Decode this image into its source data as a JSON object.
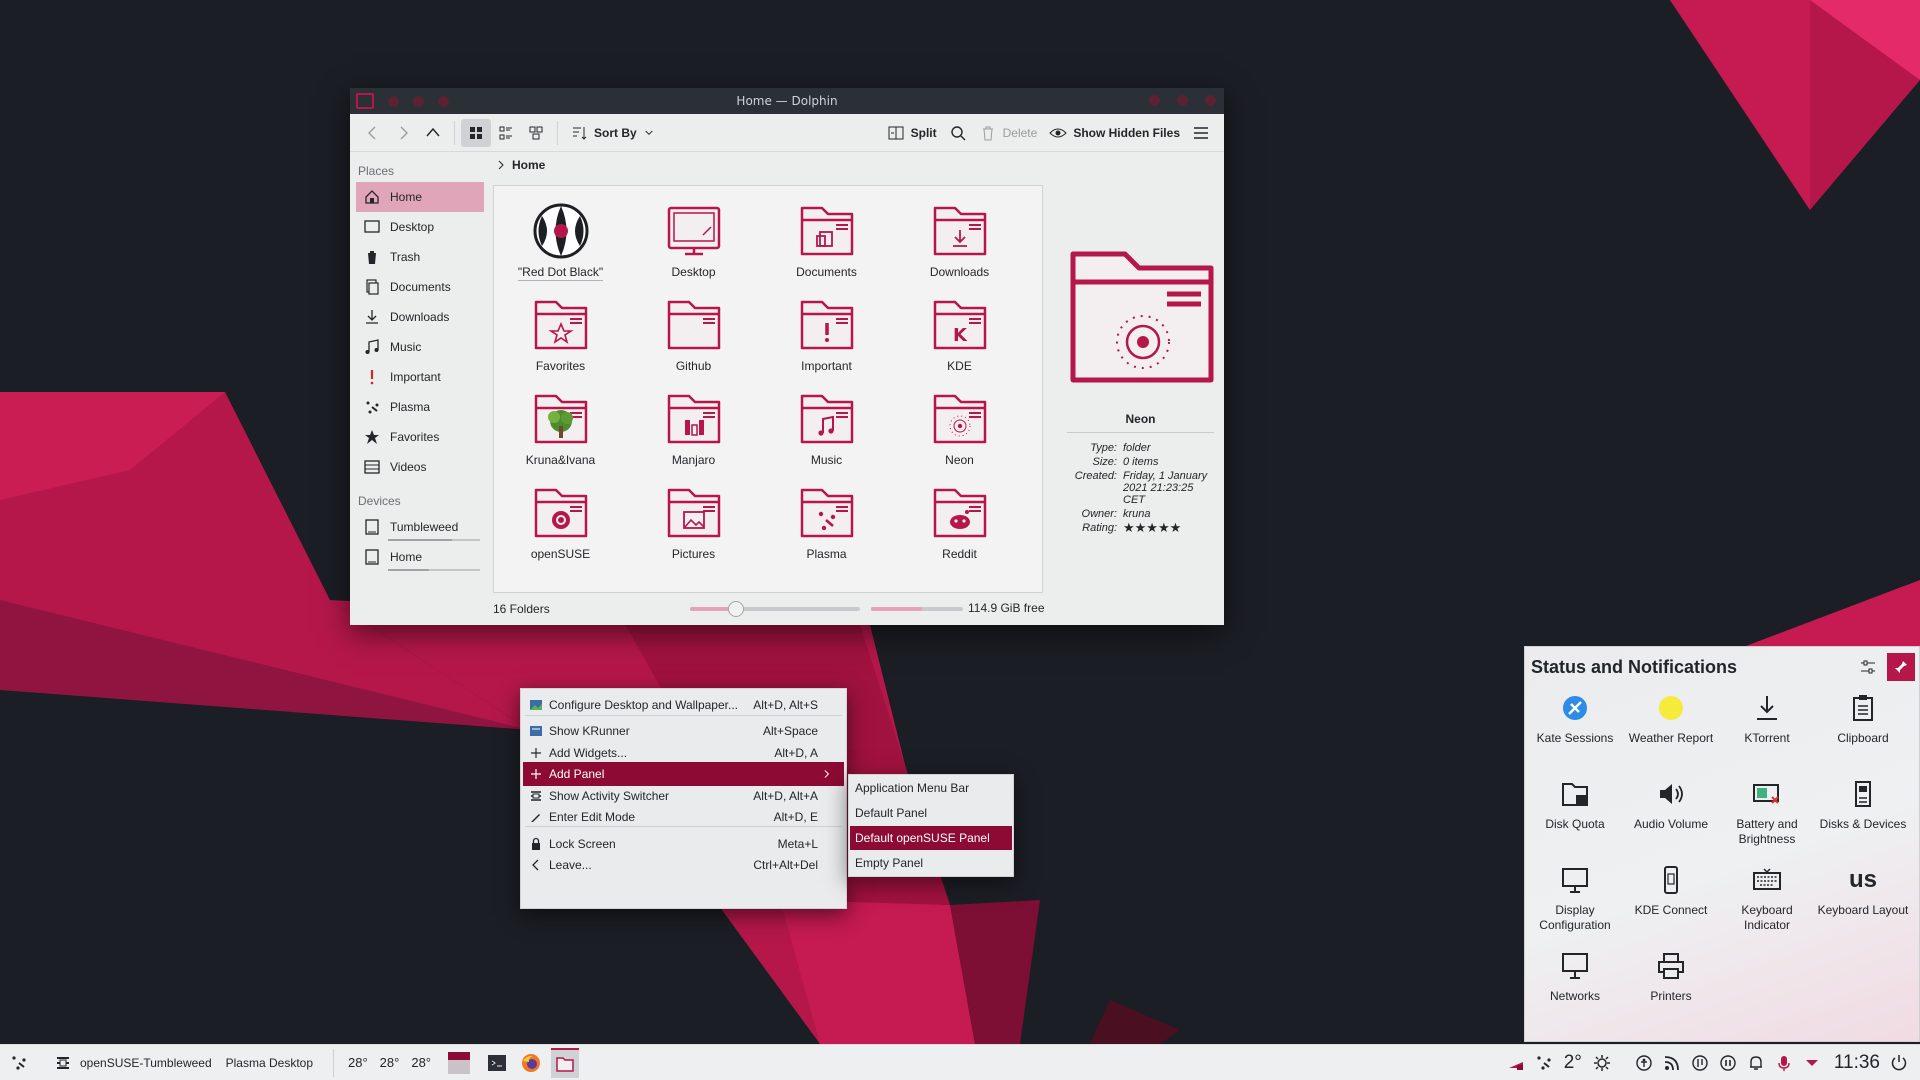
{
  "window": {
    "title": "Home — Dolphin",
    "toolbar": {
      "sort_label": "Sort By",
      "split_label": "Split",
      "delete_label": "Delete",
      "hidden_label": "Show Hidden Files"
    }
  },
  "places": {
    "header": "Places",
    "items": [
      {
        "label": "Home",
        "icon": "home-icon"
      },
      {
        "label": "Desktop",
        "icon": "desktop-icon"
      },
      {
        "label": "Trash",
        "icon": "trash-icon"
      },
      {
        "label": "Documents",
        "icon": "documents-icon"
      },
      {
        "label": "Downloads",
        "icon": "downloads-icon"
      },
      {
        "label": "Music",
        "icon": "music-icon"
      },
      {
        "label": "Important",
        "icon": "important-icon"
      },
      {
        "label": "Plasma",
        "icon": "plasma-icon"
      },
      {
        "label": "Favorites",
        "icon": "star-icon"
      },
      {
        "label": "Videos",
        "icon": "video-icon"
      }
    ],
    "devices_header": "Devices",
    "devices": [
      {
        "label": "Tumbleweed",
        "icon": "drive-icon",
        "usage": 0.7
      },
      {
        "label": "Home",
        "icon": "drive-icon",
        "usage": 0.45
      }
    ]
  },
  "breadcrumb": {
    "label": "Home"
  },
  "files": [
    {
      "label": "\"Red Dot Black\"",
      "icon": "red-dot-black-icon"
    },
    {
      "label": "Desktop",
      "icon": "desktop-folder-icon"
    },
    {
      "label": "Documents",
      "icon": "documents-folder-icon"
    },
    {
      "label": "Downloads",
      "icon": "downloads-folder-icon"
    },
    {
      "label": "Favorites",
      "icon": "favorites-folder-icon"
    },
    {
      "label": "Github",
      "icon": "folder-icon"
    },
    {
      "label": "Important",
      "icon": "important-folder-icon"
    },
    {
      "label": "KDE",
      "icon": "kde-folder-icon"
    },
    {
      "label": "Kruna&Ivana",
      "icon": "tree-folder-icon"
    },
    {
      "label": "Manjaro",
      "icon": "manjaro-folder-icon"
    },
    {
      "label": "Music",
      "icon": "music-folder-icon"
    },
    {
      "label": "Neon",
      "icon": "neon-folder-icon"
    },
    {
      "label": "openSUSE",
      "icon": "opensuse-folder-icon"
    },
    {
      "label": "Pictures",
      "icon": "pictures-folder-icon"
    },
    {
      "label": "Plasma",
      "icon": "plasma-folder-icon"
    },
    {
      "label": "Reddit",
      "icon": "reddit-folder-icon"
    }
  ],
  "statusbar": {
    "count": "16 Folders",
    "free": "114.9 GiB free",
    "zoom_level": 0.27,
    "disk_used": 0.55
  },
  "info": {
    "name": "Neon",
    "type_k": "Type:",
    "type_v": "folder",
    "size_k": "Size:",
    "size_v": "0 items",
    "created_k": "Created:",
    "created_v": "Friday, 1 January 2021 21:23:25 CET",
    "owner_k": "Owner:",
    "owner_v": "kruna",
    "rating_k": "Rating:",
    "rating_v": "★★★★★",
    "rating": 5
  },
  "context_menu": [
    {
      "label": "Configure Desktop and Wallpaper...",
      "shortcut": "Alt+D, Alt+S",
      "icon": "wallpaper-icon"
    },
    {
      "label": "Show KRunner",
      "shortcut": "Alt+Space",
      "icon": "krunner-icon"
    },
    {
      "label": "Add Widgets...",
      "shortcut": "Alt+D, A",
      "icon": "plus-icon"
    },
    {
      "label": "Add Panel",
      "shortcut": "",
      "icon": "plus-icon"
    },
    {
      "label": "Show Activity Switcher",
      "shortcut": "Alt+D, Alt+A",
      "icon": "activity-icon"
    },
    {
      "label": "Enter Edit Mode",
      "shortcut": "Alt+D, E",
      "icon": "edit-icon"
    },
    {
      "label": "Lock Screen",
      "shortcut": "Meta+L",
      "icon": "lock-icon"
    },
    {
      "label": "Leave...",
      "shortcut": "Ctrl+Alt+Del",
      "icon": "leave-icon"
    }
  ],
  "submenu": [
    {
      "label": "Application Menu Bar"
    },
    {
      "label": "Default Panel"
    },
    {
      "label": "Default openSUSE Panel"
    },
    {
      "label": "Empty Panel"
    }
  ],
  "status": {
    "title": "Status and Notifications",
    "items": [
      {
        "label": "Kate Sessions",
        "icon": "kate-icon"
      },
      {
        "label": "Weather Report",
        "icon": "sun-icon"
      },
      {
        "label": "KTorrent",
        "icon": "download-icon"
      },
      {
        "label": "Clipboard",
        "icon": "clipboard-icon"
      },
      {
        "label": "Disk Quota",
        "icon": "disk-quota-icon"
      },
      {
        "label": "Audio Volume",
        "icon": "speaker-icon"
      },
      {
        "label": "Battery and Brightness",
        "icon": "battery-icon"
      },
      {
        "label": "Disks & Devices",
        "icon": "usb-icon"
      },
      {
        "label": "Display Configuration",
        "icon": "display-icon"
      },
      {
        "label": "KDE Connect",
        "icon": "phone-icon"
      },
      {
        "label": "Keyboard Indicator",
        "icon": "keyboard-icon"
      },
      {
        "label": "Keyboard Layout",
        "icon": "keyboard-layout-icon",
        "text": "us"
      },
      {
        "label": "Networks",
        "icon": "network-icon"
      },
      {
        "label": "Printers",
        "icon": "printer-icon"
      }
    ]
  },
  "panel": {
    "activity": "openSUSE-Tumbleweed",
    "desktop": "Plasma Desktop",
    "temps": [
      "28°",
      "28°",
      "28°"
    ],
    "weather": "2°",
    "clock": "11:36"
  },
  "colors": {
    "accent": "#b5174b",
    "accent_dark": "#8c0a34"
  }
}
